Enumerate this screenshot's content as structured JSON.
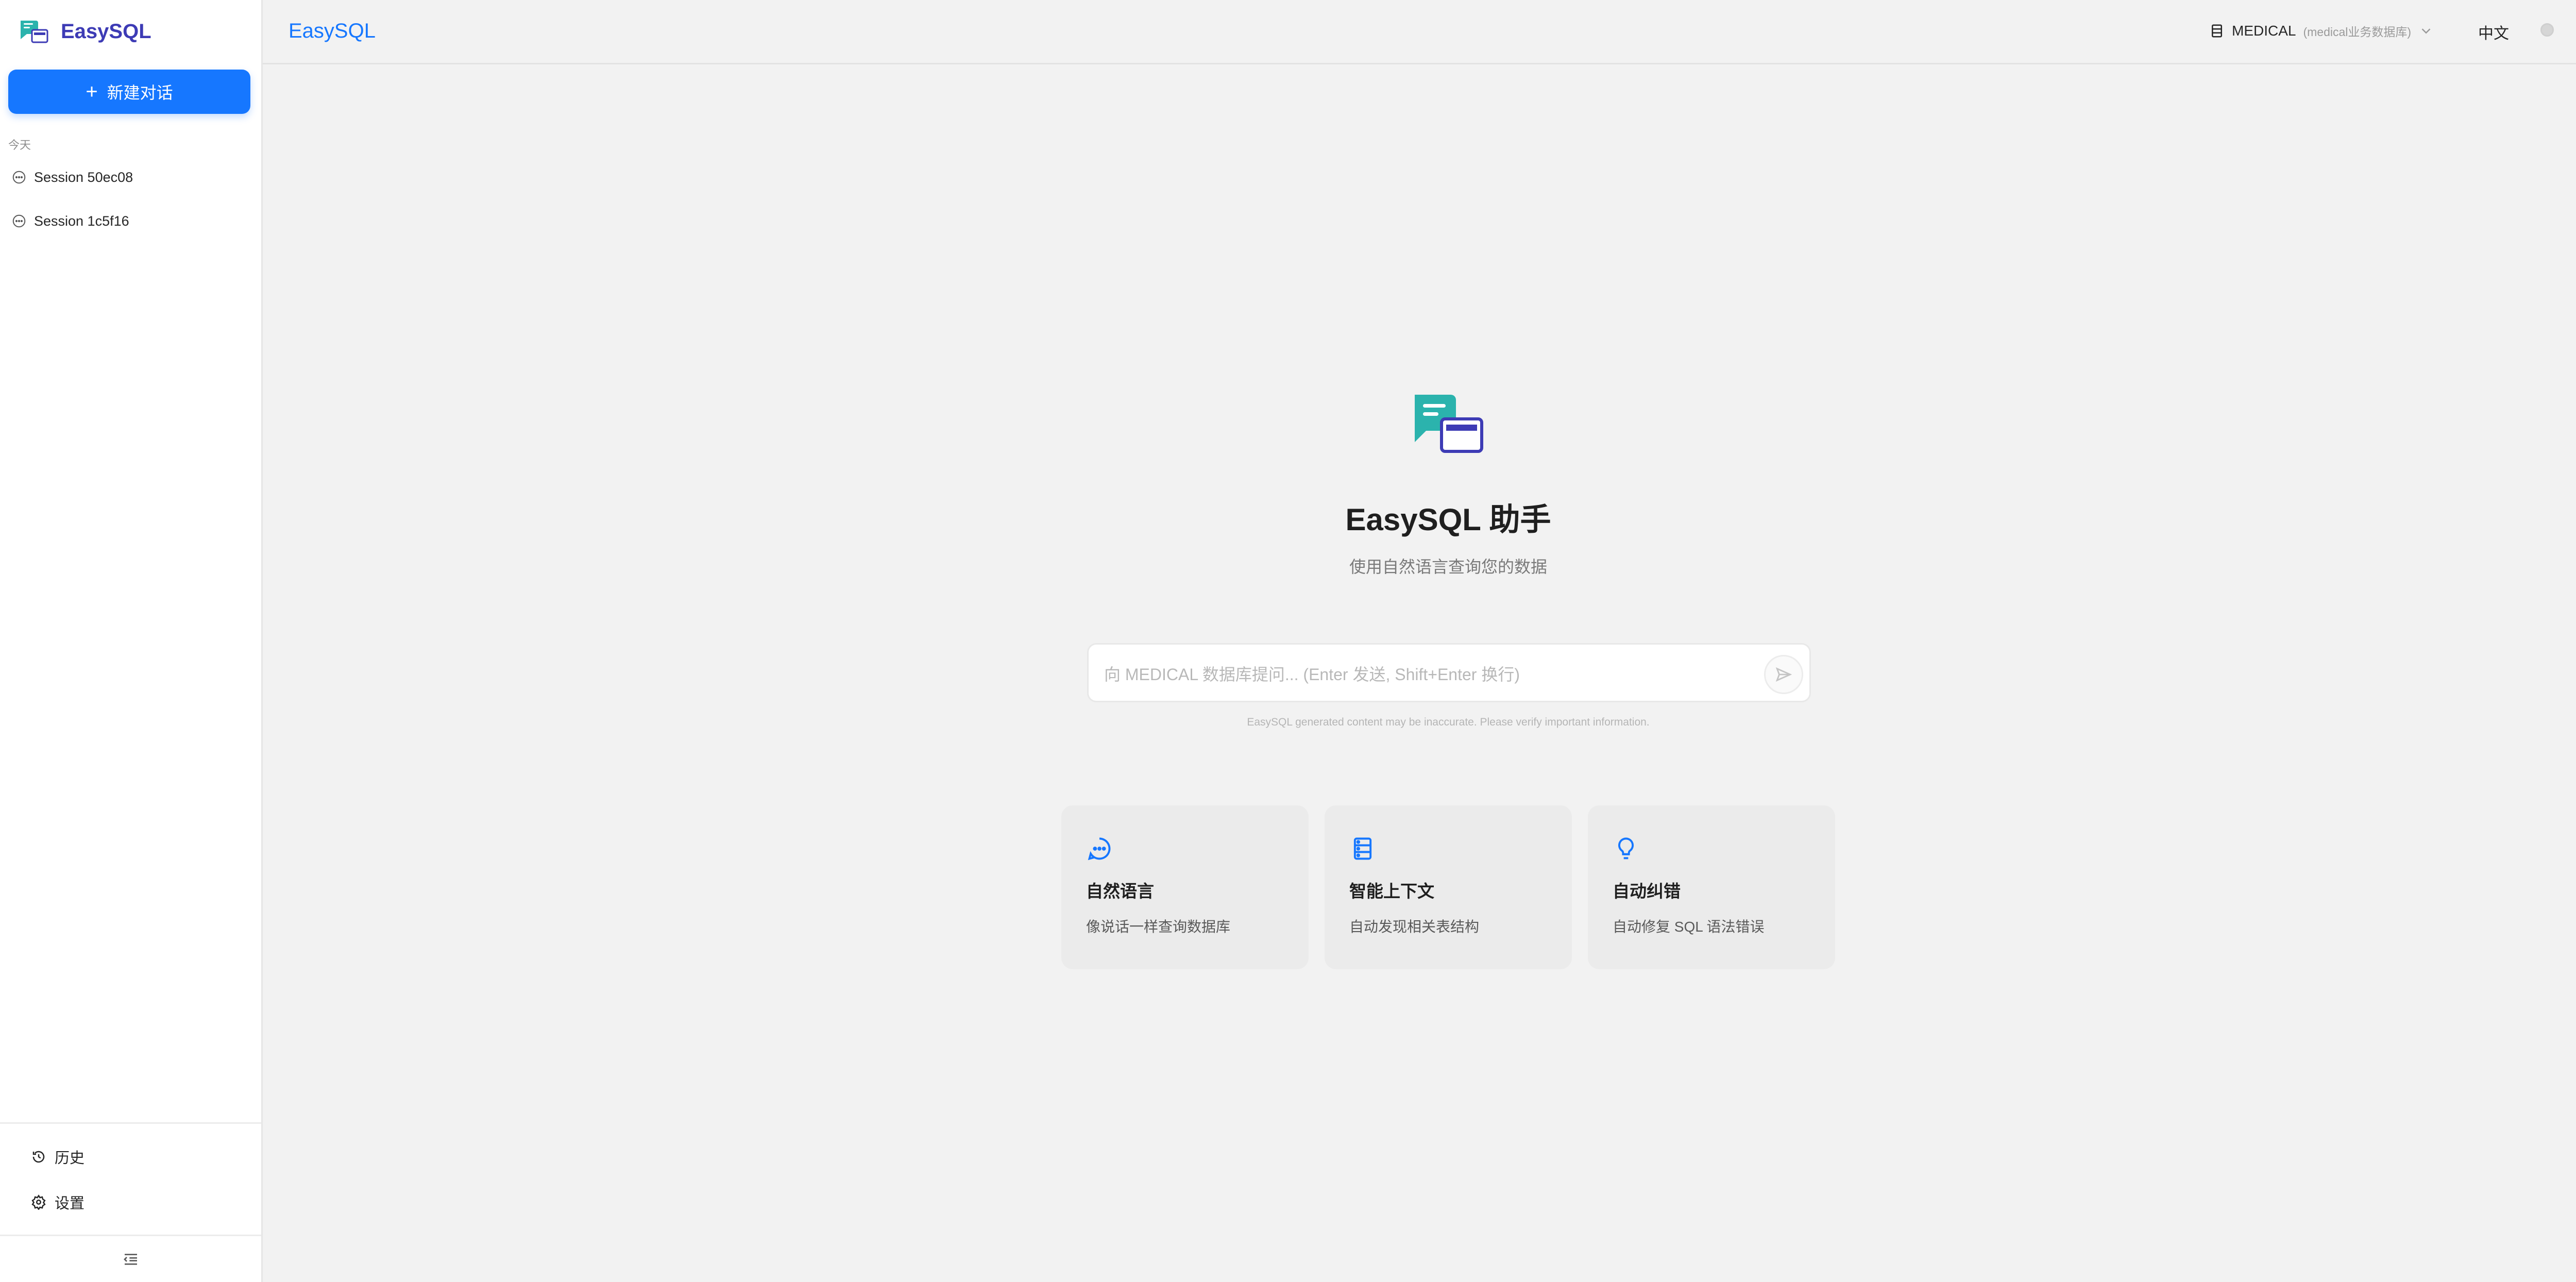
{
  "sidebar": {
    "brand": "EasySQL",
    "new_chat_label": "新建对话",
    "group_label": "今天",
    "sessions": [
      {
        "label": "Session 50ec08"
      },
      {
        "label": "Session 1c5f16"
      }
    ],
    "history_label": "历史",
    "settings_label": "设置"
  },
  "header": {
    "title": "EasySQL",
    "db_name": "MEDICAL",
    "db_desc": "(medical业务数据库)",
    "language": "中文"
  },
  "hero": {
    "title": "EasySQL 助手",
    "subtitle": "使用自然语言查询您的数据"
  },
  "input": {
    "placeholder": "向 MEDICAL 数据库提问... (Enter 发送, Shift+Enter 换行)",
    "value": ""
  },
  "disclaimer": "EasySQL generated content may be inaccurate. Please verify important information.",
  "features": [
    {
      "icon": "chat-bubble-icon",
      "title": "自然语言",
      "desc": "像说话一样查询数据库"
    },
    {
      "icon": "database-icon",
      "title": "智能上下文",
      "desc": "自动发现相关表结构"
    },
    {
      "icon": "lightbulb-icon",
      "title": "自动纠错",
      "desc": "自动修复 SQL 语法错误"
    }
  ],
  "colors": {
    "accent": "#1677ff",
    "brand_text": "#3d3bb5",
    "logo_teal": "#2bb3ad",
    "logo_indigo": "#3d3bb5",
    "background": "#f2f2f2",
    "sidebar_bg": "#ffffff",
    "card_bg": "#ebebeb"
  }
}
